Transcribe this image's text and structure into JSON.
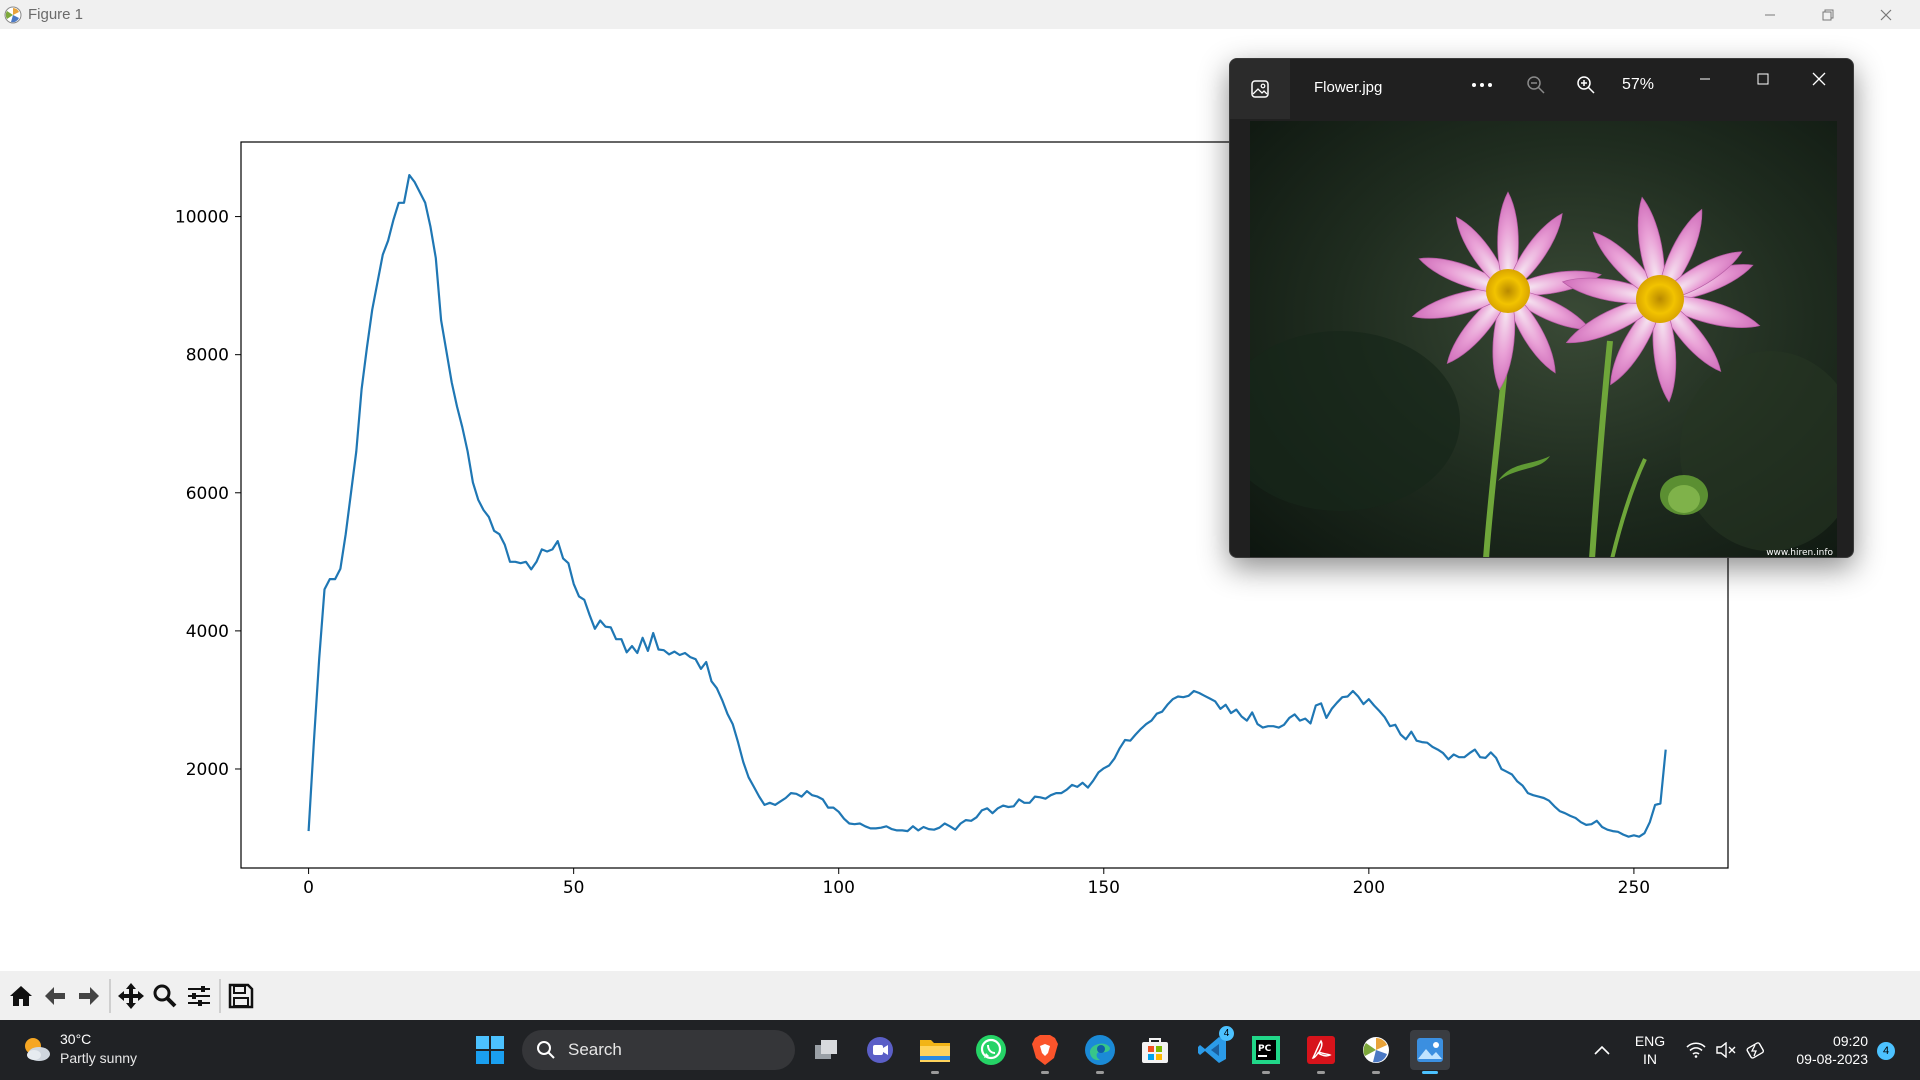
{
  "window": {
    "title": "Figure 1",
    "controls": [
      "minimize-icon",
      "restore-icon",
      "close-icon"
    ]
  },
  "chart_data": {
    "type": "line",
    "title": "",
    "xlabel": "",
    "ylabel": "",
    "xlim": [
      -12.75,
      267.75
    ],
    "ylim": [
      566,
      11080
    ],
    "xticks": [
      0,
      50,
      100,
      150,
      200,
      250
    ],
    "yticks": [
      2000,
      4000,
      6000,
      8000,
      10000
    ],
    "grid": false,
    "color": "#1f77b4",
    "series": [
      {
        "points": [
          [
            0,
            1100
          ],
          [
            1,
            2400
          ],
          [
            2,
            3600
          ],
          [
            3,
            4600
          ],
          [
            4,
            4750
          ],
          [
            5,
            4750
          ],
          [
            6,
            4900
          ],
          [
            7,
            5400
          ],
          [
            8,
            6000
          ],
          [
            9,
            6600
          ],
          [
            10,
            7500
          ],
          [
            11,
            8100
          ],
          [
            12,
            8650
          ],
          [
            13,
            9050
          ],
          [
            14,
            9450
          ],
          [
            15,
            9650
          ],
          [
            16,
            9950
          ],
          [
            17,
            10200
          ],
          [
            18,
            10200
          ],
          [
            19,
            10600
          ],
          [
            20,
            10500
          ],
          [
            21,
            10350
          ],
          [
            22,
            10200
          ],
          [
            23,
            9850
          ],
          [
            24,
            9400
          ],
          [
            25,
            8500
          ],
          [
            26,
            8050
          ],
          [
            27,
            7600
          ],
          [
            28,
            7250
          ],
          [
            29,
            6950
          ],
          [
            30,
            6600
          ],
          [
            31,
            6150
          ],
          [
            32,
            5900
          ],
          [
            33,
            5750
          ],
          [
            34,
            5650
          ],
          [
            35,
            5450
          ],
          [
            36,
            5400
          ],
          [
            37,
            5250
          ],
          [
            38,
            5000
          ],
          [
            39,
            5000
          ],
          [
            40,
            4980
          ],
          [
            41,
            5000
          ],
          [
            42,
            4890
          ],
          [
            43,
            5000
          ],
          [
            44,
            5180
          ],
          [
            45,
            5150
          ],
          [
            46,
            5180
          ],
          [
            47,
            5300
          ],
          [
            48,
            5050
          ],
          [
            49,
            4980
          ],
          [
            50,
            4680
          ],
          [
            51,
            4500
          ],
          [
            52,
            4450
          ],
          [
            53,
            4230
          ],
          [
            54,
            4030
          ],
          [
            55,
            4150
          ],
          [
            56,
            4060
          ],
          [
            57,
            4050
          ],
          [
            58,
            3880
          ],
          [
            59,
            3880
          ],
          [
            60,
            3690
          ],
          [
            61,
            3780
          ],
          [
            62,
            3680
          ],
          [
            63,
            3900
          ],
          [
            64,
            3710
          ],
          [
            65,
            3970
          ],
          [
            66,
            3730
          ],
          [
            67,
            3720
          ],
          [
            68,
            3660
          ],
          [
            69,
            3700
          ],
          [
            70,
            3650
          ],
          [
            71,
            3680
          ],
          [
            72,
            3620
          ],
          [
            73,
            3590
          ],
          [
            74,
            3450
          ],
          [
            75,
            3550
          ],
          [
            76,
            3270
          ],
          [
            77,
            3170
          ],
          [
            78,
            3000
          ],
          [
            79,
            2800
          ],
          [
            80,
            2650
          ],
          [
            81,
            2390
          ],
          [
            82,
            2100
          ],
          [
            83,
            1880
          ],
          [
            84,
            1740
          ],
          [
            85,
            1600
          ],
          [
            86,
            1480
          ],
          [
            87,
            1510
          ],
          [
            88,
            1480
          ],
          [
            89,
            1530
          ],
          [
            90,
            1580
          ],
          [
            91,
            1650
          ],
          [
            92,
            1640
          ],
          [
            93,
            1600
          ],
          [
            94,
            1680
          ],
          [
            95,
            1620
          ],
          [
            96,
            1600
          ],
          [
            97,
            1560
          ],
          [
            98,
            1440
          ],
          [
            99,
            1440
          ],
          [
            100,
            1380
          ],
          [
            101,
            1280
          ],
          [
            102,
            1210
          ],
          [
            103,
            1200
          ],
          [
            104,
            1210
          ],
          [
            105,
            1170
          ],
          [
            106,
            1140
          ],
          [
            107,
            1140
          ],
          [
            108,
            1150
          ],
          [
            109,
            1170
          ],
          [
            110,
            1130
          ],
          [
            111,
            1110
          ],
          [
            112,
            1110
          ],
          [
            113,
            1100
          ],
          [
            114,
            1170
          ],
          [
            115,
            1110
          ],
          [
            116,
            1160
          ],
          [
            117,
            1130
          ],
          [
            118,
            1120
          ],
          [
            119,
            1150
          ],
          [
            120,
            1210
          ],
          [
            121,
            1170
          ],
          [
            122,
            1120
          ],
          [
            123,
            1210
          ],
          [
            124,
            1260
          ],
          [
            125,
            1250
          ],
          [
            126,
            1300
          ],
          [
            127,
            1400
          ],
          [
            128,
            1430
          ],
          [
            129,
            1360
          ],
          [
            130,
            1430
          ],
          [
            131,
            1470
          ],
          [
            132,
            1450
          ],
          [
            133,
            1460
          ],
          [
            134,
            1560
          ],
          [
            135,
            1510
          ],
          [
            136,
            1510
          ],
          [
            137,
            1600
          ],
          [
            138,
            1590
          ],
          [
            139,
            1570
          ],
          [
            140,
            1620
          ],
          [
            141,
            1650
          ],
          [
            142,
            1650
          ],
          [
            143,
            1700
          ],
          [
            144,
            1770
          ],
          [
            145,
            1740
          ],
          [
            146,
            1800
          ],
          [
            147,
            1730
          ],
          [
            148,
            1830
          ],
          [
            149,
            1950
          ],
          [
            150,
            2010
          ],
          [
            151,
            2050
          ],
          [
            152,
            2150
          ],
          [
            153,
            2300
          ],
          [
            154,
            2420
          ],
          [
            155,
            2410
          ],
          [
            156,
            2500
          ],
          [
            157,
            2580
          ],
          [
            158,
            2650
          ],
          [
            159,
            2700
          ],
          [
            160,
            2800
          ],
          [
            161,
            2830
          ],
          [
            162,
            2930
          ],
          [
            163,
            3010
          ],
          [
            164,
            3050
          ],
          [
            165,
            3040
          ],
          [
            166,
            3060
          ],
          [
            167,
            3130
          ],
          [
            168,
            3100
          ],
          [
            169,
            3060
          ],
          [
            170,
            3020
          ],
          [
            171,
            2980
          ],
          [
            172,
            2870
          ],
          [
            173,
            2930
          ],
          [
            174,
            2810
          ],
          [
            175,
            2860
          ],
          [
            176,
            2760
          ],
          [
            177,
            2700
          ],
          [
            178,
            2820
          ],
          [
            179,
            2650
          ],
          [
            180,
            2600
          ],
          [
            181,
            2620
          ],
          [
            182,
            2620
          ],
          [
            183,
            2600
          ],
          [
            184,
            2640
          ],
          [
            185,
            2740
          ],
          [
            186,
            2790
          ],
          [
            187,
            2700
          ],
          [
            188,
            2730
          ],
          [
            189,
            2660
          ],
          [
            190,
            2920
          ],
          [
            191,
            2950
          ],
          [
            192,
            2740
          ],
          [
            193,
            2870
          ],
          [
            194,
            2960
          ],
          [
            195,
            3040
          ],
          [
            196,
            3050
          ],
          [
            197,
            3130
          ],
          [
            198,
            3050
          ],
          [
            199,
            2940
          ],
          [
            200,
            3010
          ],
          [
            201,
            2920
          ],
          [
            202,
            2840
          ],
          [
            203,
            2750
          ],
          [
            204,
            2620
          ],
          [
            205,
            2640
          ],
          [
            206,
            2500
          ],
          [
            207,
            2430
          ],
          [
            208,
            2540
          ],
          [
            209,
            2410
          ],
          [
            210,
            2390
          ],
          [
            211,
            2380
          ],
          [
            212,
            2320
          ],
          [
            213,
            2280
          ],
          [
            214,
            2230
          ],
          [
            215,
            2140
          ],
          [
            216,
            2210
          ],
          [
            217,
            2170
          ],
          [
            218,
            2170
          ],
          [
            219,
            2230
          ],
          [
            220,
            2280
          ],
          [
            221,
            2170
          ],
          [
            222,
            2160
          ],
          [
            223,
            2240
          ],
          [
            224,
            2160
          ],
          [
            225,
            2000
          ],
          [
            226,
            1960
          ],
          [
            227,
            1920
          ],
          [
            228,
            1820
          ],
          [
            229,
            1760
          ],
          [
            230,
            1650
          ],
          [
            231,
            1620
          ],
          [
            232,
            1600
          ],
          [
            233,
            1580
          ],
          [
            234,
            1540
          ],
          [
            235,
            1460
          ],
          [
            236,
            1390
          ],
          [
            237,
            1360
          ],
          [
            238,
            1320
          ],
          [
            239,
            1290
          ],
          [
            240,
            1230
          ],
          [
            241,
            1190
          ],
          [
            242,
            1200
          ],
          [
            243,
            1250
          ],
          [
            244,
            1160
          ],
          [
            245,
            1120
          ],
          [
            246,
            1100
          ],
          [
            247,
            1090
          ],
          [
            248,
            1050
          ],
          [
            249,
            1020
          ],
          [
            250,
            1040
          ],
          [
            251,
            1020
          ],
          [
            252,
            1070
          ],
          [
            253,
            1230
          ],
          [
            254,
            1480
          ],
          [
            255,
            1500
          ],
          [
            256,
            2280
          ]
        ]
      }
    ]
  },
  "toolbar": {
    "buttons": [
      "home-icon",
      "back-icon",
      "forward-icon",
      "pan-icon",
      "zoom-icon",
      "configure-subplots-icon",
      "save-icon"
    ]
  },
  "photos": {
    "filename": "Flower.jpg",
    "zoom": "57%",
    "watermark": "www.hiren.info",
    "controls": [
      "more-options-icon",
      "zoom-out-icon",
      "zoom-in-icon",
      "minimize-icon",
      "maximize-icon",
      "close-icon"
    ]
  },
  "taskbar": {
    "weather_temp": "30°C",
    "weather_desc": "Partly sunny",
    "search_label": "Search",
    "apps": [
      "task-view",
      "teams-chat",
      "file-explorer",
      "whatsapp",
      "brave",
      "edge",
      "microsoft-store",
      "vscode",
      "pycharm",
      "acrobat",
      "matplotlib",
      "photos"
    ],
    "vscode_badge": "4",
    "language": "ENG",
    "region": "IN",
    "time": "09:20",
    "date": "09-08-2023",
    "notification_count": "4"
  }
}
